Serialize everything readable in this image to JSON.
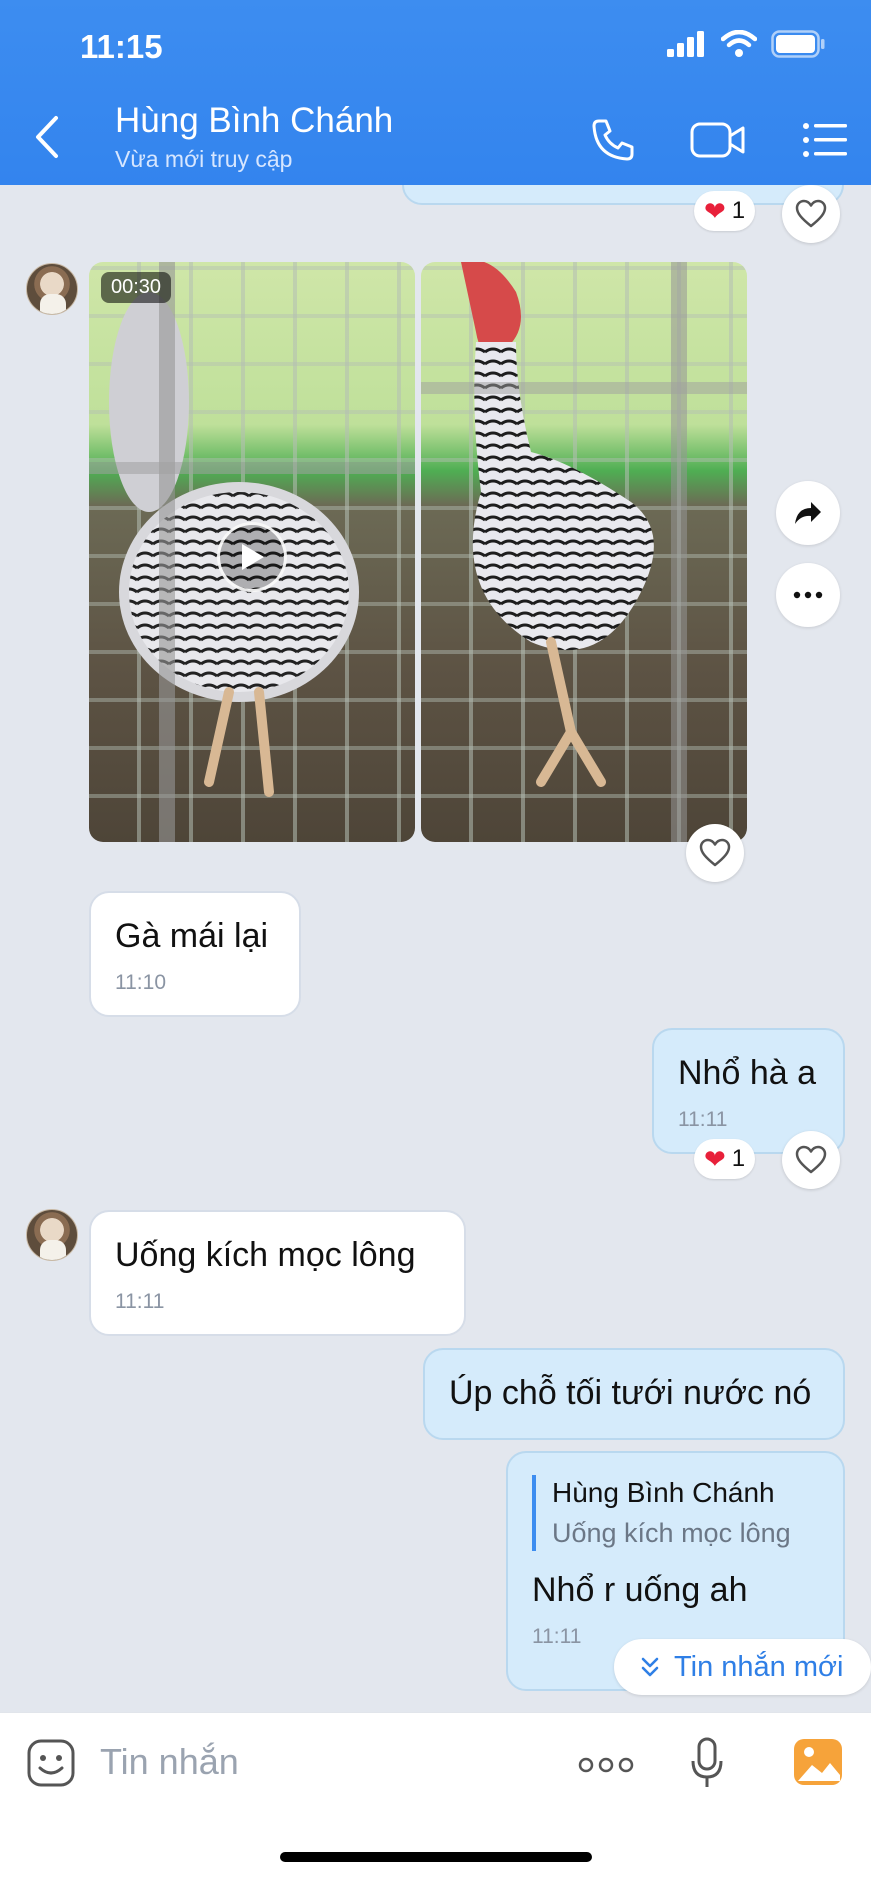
{
  "status_bar": {
    "time": "11:15"
  },
  "header": {
    "title": "Hùng Bình Chánh",
    "subtitle": "Vừa mới truy cập"
  },
  "messages": {
    "top_reaction": {
      "emoji": "❤️",
      "count": "1"
    },
    "media": {
      "duration": "00:30"
    },
    "m1": {
      "text": "Gà mái lại",
      "time": "11:10"
    },
    "m2": {
      "text": "Nhổ hà a",
      "time": "11:11",
      "reaction": {
        "emoji": "❤️",
        "count": "1"
      }
    },
    "m3": {
      "text": "Uống kích mọc lông",
      "time": "11:11"
    },
    "m4": {
      "text": "Úp chỗ tối tưới nước nó"
    },
    "m5": {
      "quote_name": "Hùng Bình Chánh",
      "quote_text": "Uống kích mọc lông",
      "text": "Nhổ r uống ah",
      "time": "11:11"
    }
  },
  "new_message_pill": "Tin nhắn mới",
  "composer": {
    "placeholder": "Tin nhắn"
  },
  "colors": {
    "header": "#3d8df0",
    "accent": "#2f7fe6",
    "heart": "#e8203a"
  }
}
